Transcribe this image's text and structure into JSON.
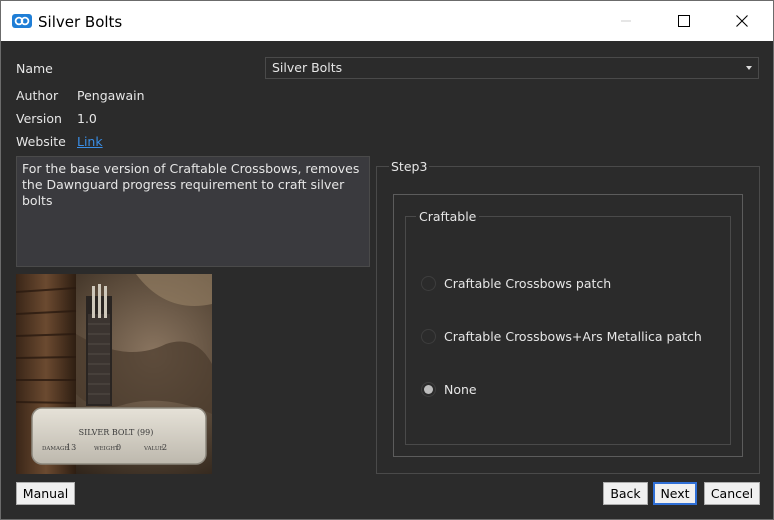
{
  "window": {
    "title": "Silver Bolts",
    "controls": {
      "minimize": "—",
      "maximize": "☐",
      "close": "✕"
    }
  },
  "info": {
    "name_label": "Name",
    "name_value": "Silver Bolts",
    "author_label": "Author",
    "author_value": "Pengawain",
    "version_label": "Version",
    "version_value": "1.0",
    "website_label": "Website",
    "website_link": "Link"
  },
  "description": "For the base version of Craftable Crossbows, removes the Dawnguard progress requirement to craft silver bolts",
  "preview": {
    "item_name": "SILVER BOLT (99)",
    "damage_label": "DAMAGE",
    "damage_value": "13",
    "weight_label": "WEIGHT",
    "weight_value": "0",
    "value_label": "VALUE",
    "value_value": "2"
  },
  "step": {
    "title": "Step3",
    "group_title": "Craftable",
    "options": [
      {
        "label": "Craftable Crossbows patch",
        "selected": false
      },
      {
        "label": "Craftable Crossbows+Ars Metallica patch",
        "selected": false
      },
      {
        "label": "None",
        "selected": true
      }
    ]
  },
  "buttons": {
    "manual": "Manual",
    "back": "Back",
    "next": "Next",
    "cancel": "Cancel"
  },
  "colors": {
    "background": "#2b2b2b",
    "link": "#3a8ee6",
    "default_button_border": "#2f6fd6"
  }
}
